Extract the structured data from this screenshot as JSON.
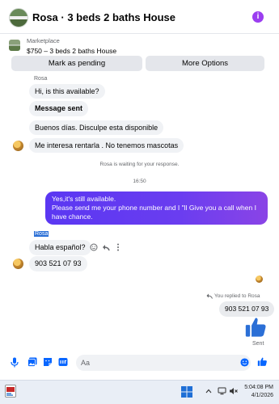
{
  "header": {
    "title": "Rosa · 3 beds 2 baths House",
    "info_glyph": "i"
  },
  "marketplace": {
    "kind": "Marketplace",
    "listing": "$750 – 3 beds 2 baths House",
    "pending_label": "Mark as pending",
    "more_label": "More Options"
  },
  "thread": {
    "top_sender": "Rosa",
    "messages": [
      {
        "text": "Hi, is this available?"
      },
      {
        "text": "Message sent"
      },
      {
        "text": "Buenos días.  Disculpe esta disponible"
      },
      {
        "text": "Me interesa rentarla . No tenemos mascotas"
      }
    ],
    "waiting_note": "Rosa is waiting for your response.",
    "time_divider": "16:50",
    "outgoing": "Yes,it's still available.\nPlease send me your phone number and I \"ll Give you a call when I have chance.",
    "second_sender": "Rosa",
    "question": "Habla español?",
    "phone": "903 521 07 93",
    "reply_note": "You replied to Rosa",
    "quoted_reply": "903 521 07 93",
    "sent_status": "Sent"
  },
  "composer": {
    "placeholder": "Aa"
  },
  "taskbar": {
    "time": "5:04:08 PM",
    "date": "4/1/2026"
  },
  "colors": {
    "accent": "#0866ff",
    "outgoing_start": "#5a37f2",
    "outgoing_end": "#8a44e6",
    "info": "#9b3ef0"
  },
  "icons": [
    "info-icon",
    "reaction-icon",
    "reply-icon",
    "more-icon",
    "thumbs-up-icon",
    "mic-icon",
    "image-icon",
    "sticker-icon",
    "gif-icon",
    "emoji-icon",
    "send-like-icon"
  ]
}
